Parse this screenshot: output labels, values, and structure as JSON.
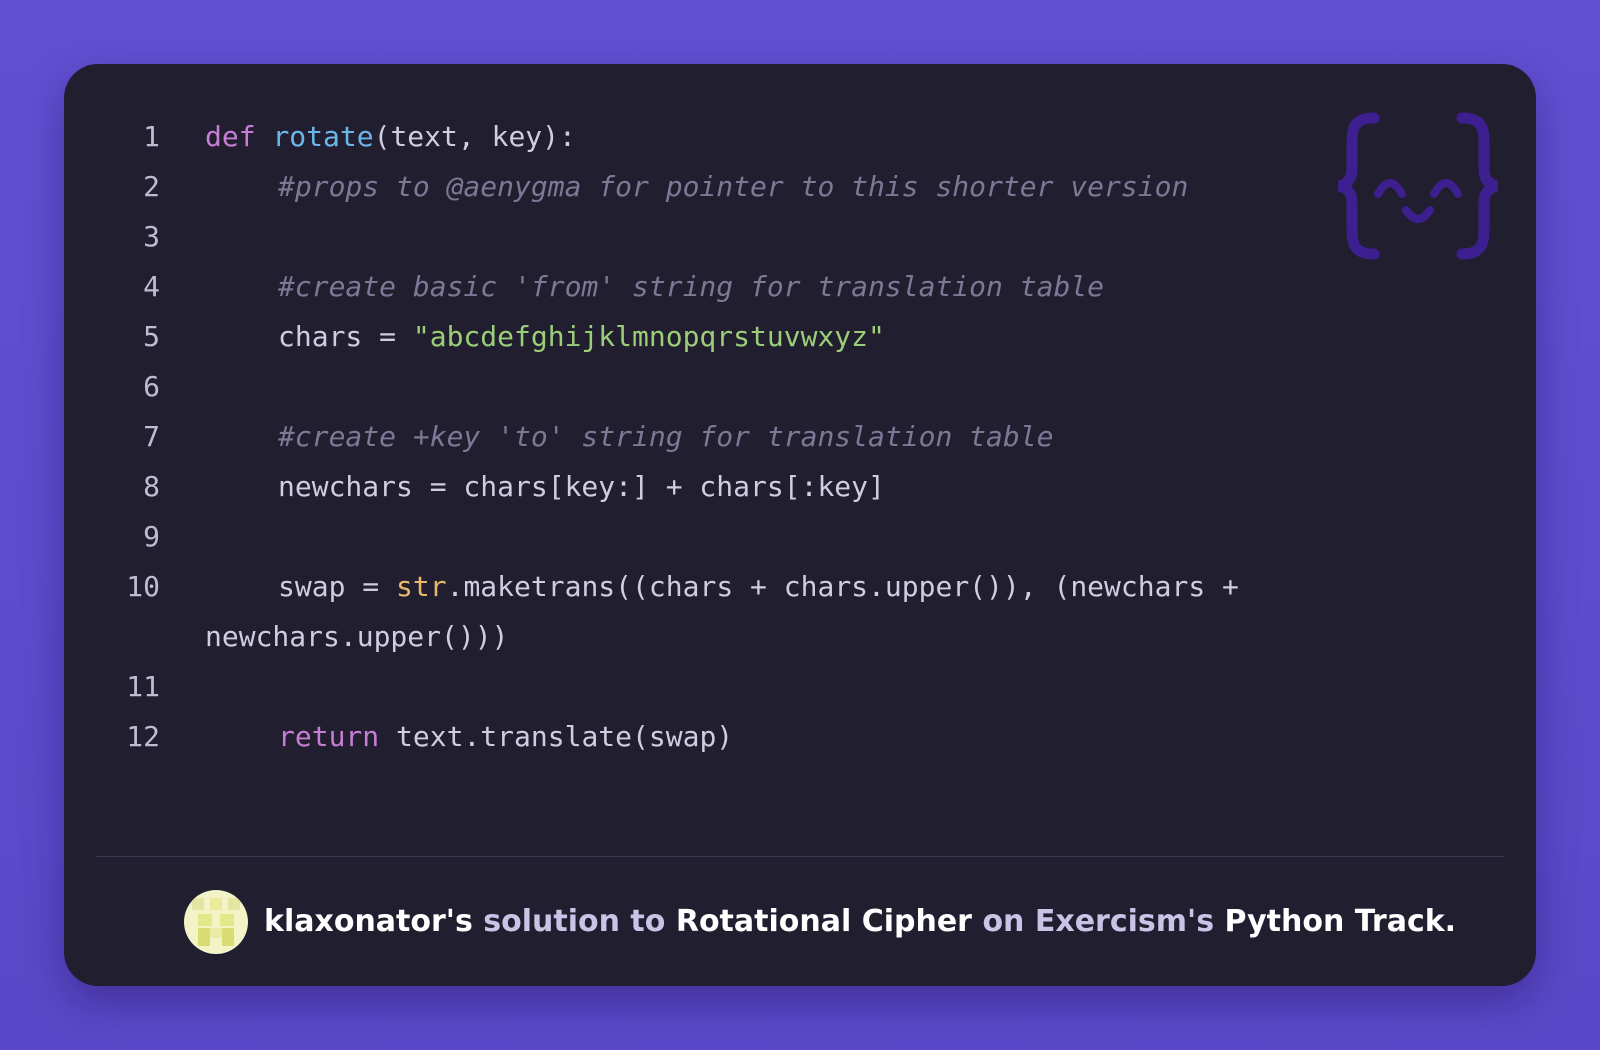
{
  "colors": {
    "background": "#5e4dcf",
    "card": "#211e30",
    "keyword": "#c77dd4",
    "function": "#6cb5e8",
    "comment": "#7c7896",
    "string": "#9ccd77",
    "builtin": "#e8b86a",
    "text": "#d0cde0"
  },
  "logo_icon": "exercism-curly-braces-smile-icon",
  "code": {
    "lines": [
      {
        "num": "1",
        "parts": [
          "def",
          " ",
          "rotate",
          "(text, key):"
        ]
      },
      {
        "num": "2",
        "comment": "#props to @aenygma for pointer to this shorter version"
      },
      {
        "num": "3"
      },
      {
        "num": "4",
        "comment": "#create basic 'from' string for translation table"
      },
      {
        "num": "5",
        "pre": "chars = ",
        "string": "\"abcdefghijklmnopqrstuvwxyz\""
      },
      {
        "num": "6"
      },
      {
        "num": "7",
        "comment": "#create +key 'to' string for translation table"
      },
      {
        "num": "8",
        "text": "newchars = chars[key:] + chars[:key]"
      },
      {
        "num": "9"
      },
      {
        "num": "10",
        "pre": "swap = ",
        "builtin": "str",
        "post": ".maketrans((chars + chars.upper()), (newchars +",
        "continuation": "newchars.upper()))"
      },
      {
        "num": "11"
      },
      {
        "num": "12",
        "keyword": "return",
        "post": " text.translate(swap)"
      }
    ]
  },
  "footer": {
    "avatar_icon": "user-avatar-icon",
    "username": "klaxonator's",
    "solution_to": "solution to",
    "exercise": "Rotational Cipher",
    "on": "on",
    "site": "Exercism's",
    "track": "Python Track."
  }
}
